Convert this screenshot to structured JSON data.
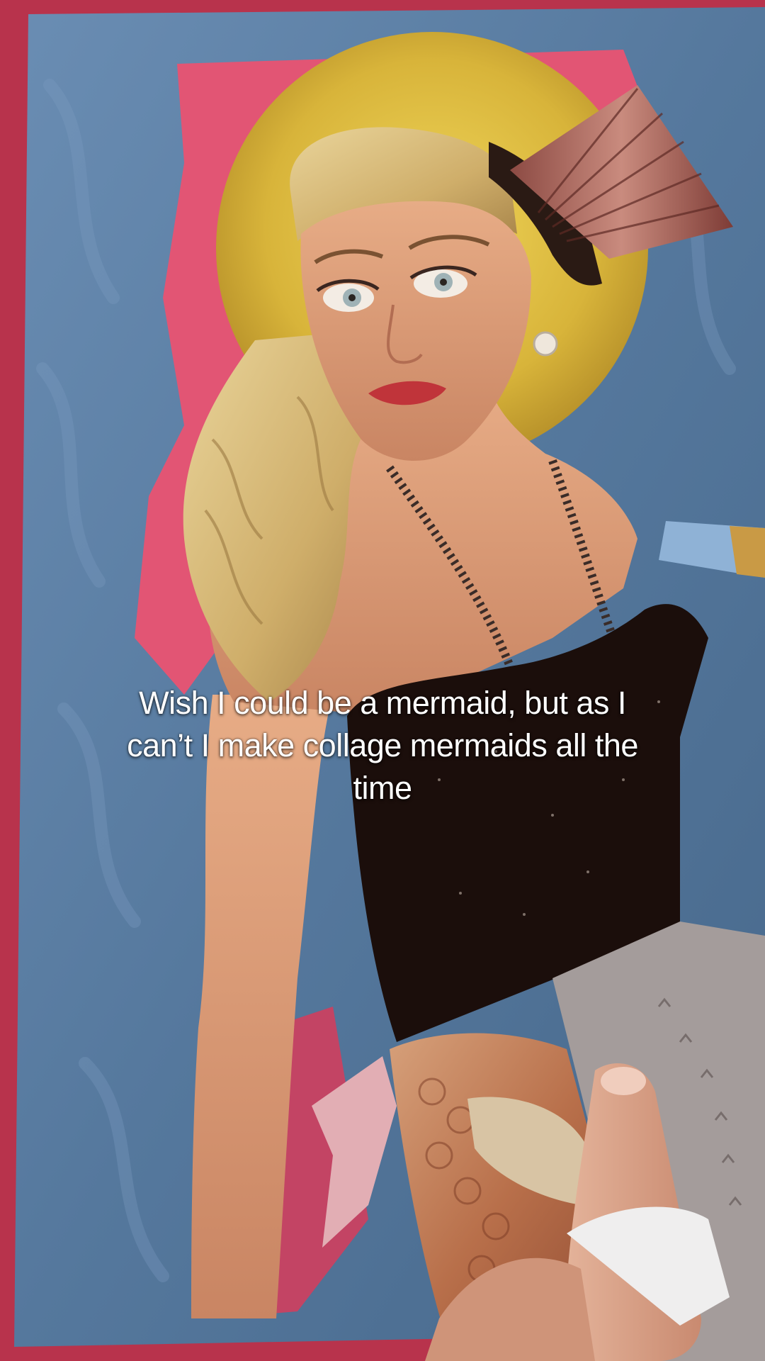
{
  "caption": {
    "line1": "Wish I could be a mermaid, but as I",
    "line2": "can’t I make collage mermaids all the",
    "line3": "time"
  },
  "colors": {
    "table_red": "#c2354f",
    "board_blue": "#5a7ea3",
    "paint_pink": "#e0506e",
    "halo_gold": "#d9b73a",
    "hair_blonde": "#d8bb78",
    "skin": "#d99873",
    "top_black": "#1c0f0c",
    "tail_scales": "#c0805a",
    "caption_text": "#ffffff"
  }
}
